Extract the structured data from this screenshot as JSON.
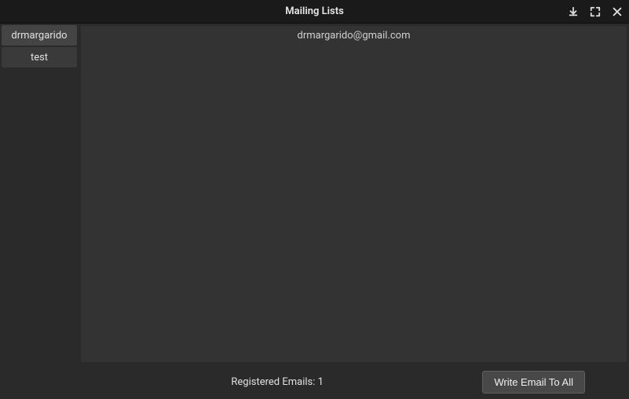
{
  "window": {
    "title": "Mailing Lists"
  },
  "sidebar": {
    "items": [
      {
        "label": "drmargarido",
        "selected": true
      },
      {
        "label": "test",
        "selected": false
      }
    ]
  },
  "main": {
    "emails": [
      "drmargarido@gmail.com"
    ]
  },
  "footer": {
    "status_prefix": "Registered Emails: ",
    "status_count": "1",
    "write_all_label": "Write Email To All"
  }
}
